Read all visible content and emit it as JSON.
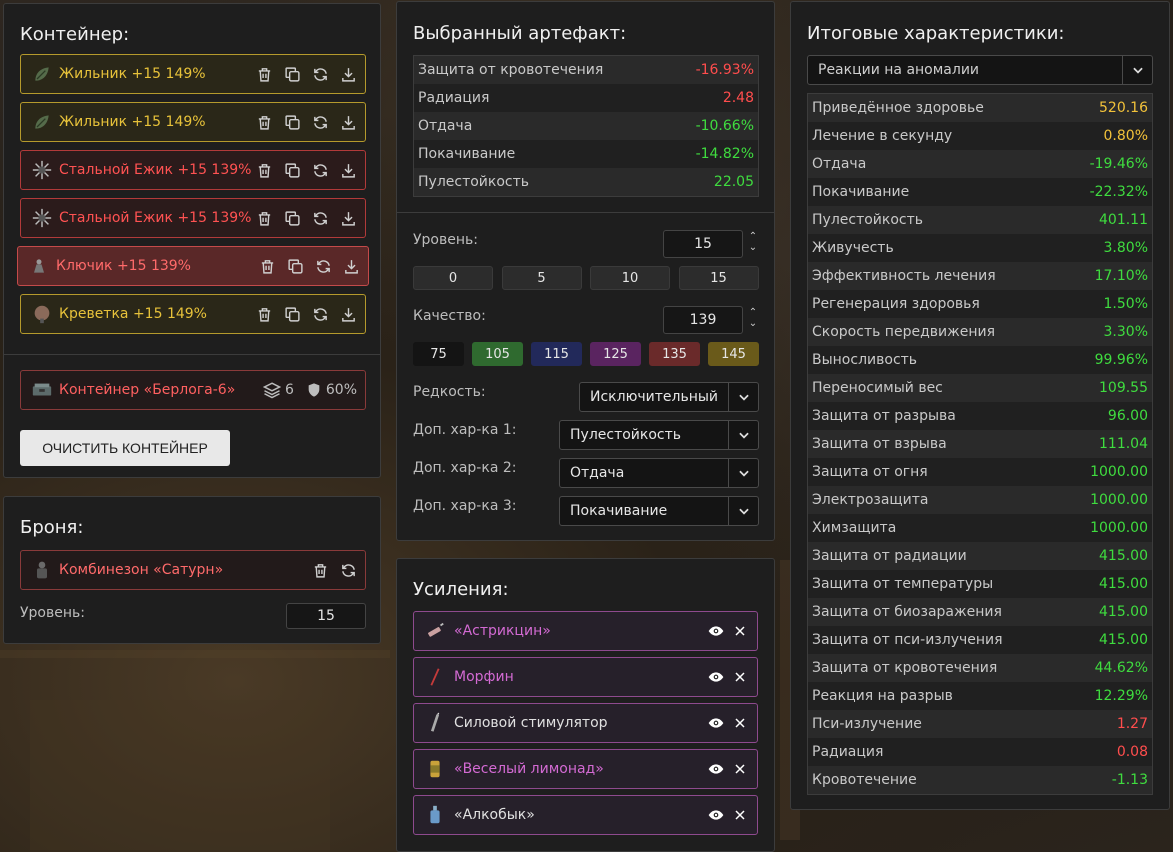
{
  "colors": {
    "gold": "#e7c23a",
    "red": "#ff5252",
    "green": "#3fdc3f",
    "purple": "#d36ad3"
  },
  "container": {
    "title": "Контейнер:",
    "items": [
      {
        "label": "Жильник +15 149%",
        "style": "gold",
        "icon": "leaf-artifact-icon"
      },
      {
        "label": "Жильник +15 149%",
        "style": "gold",
        "icon": "leaf-artifact-icon"
      },
      {
        "label": "Стальной Ежик +15 139%",
        "style": "red",
        "icon": "spiky-artifact-icon"
      },
      {
        "label": "Стальной Ежик +15 139%",
        "style": "red",
        "icon": "spiky-artifact-icon"
      },
      {
        "label": "Ключик +15 139%",
        "style": "red-sel",
        "icon": "key-artifact-icon"
      },
      {
        "label": "Креветка +15 149%",
        "style": "gold",
        "icon": "shrimp-artifact-icon"
      }
    ],
    "box": {
      "label": "Контейнер «Берлога-6»",
      "slots": "6",
      "protection": "60%"
    },
    "clear_label": "ОЧИСТИТЬ КОНТЕЙНЕР"
  },
  "armor": {
    "title": "Броня:",
    "item": "Комбинезон «Сатурн»",
    "level_label": "Уровень:",
    "level": "15"
  },
  "artifact": {
    "title": "Выбранный артефакт:",
    "stats": [
      {
        "label": "Защита от кровотечения",
        "value": "-16.93%",
        "color": "red"
      },
      {
        "label": "Радиация",
        "value": "2.48",
        "color": "red"
      },
      {
        "label": "Отдача",
        "value": "-10.66%",
        "color": "green"
      },
      {
        "label": "Покачивание",
        "value": "-14.82%",
        "color": "green"
      },
      {
        "label": "Пулестойкость",
        "value": "22.05",
        "color": "green"
      }
    ],
    "level_label": "Уровень:",
    "level": "15",
    "level_presets": [
      "0",
      "5",
      "10",
      "15"
    ],
    "quality_label": "Качество:",
    "quality": "139",
    "quality_presets": [
      {
        "label": "75",
        "bg": "#141414"
      },
      {
        "label": "105",
        "bg": "#2f6a2f"
      },
      {
        "label": "115",
        "bg": "#22295a"
      },
      {
        "label": "125",
        "bg": "#5a2460"
      },
      {
        "label": "135",
        "bg": "#6a2a2a"
      },
      {
        "label": "145",
        "bg": "#6a5a1a"
      }
    ],
    "rarity_label": "Редкость:",
    "rarity": "Исключительный",
    "extra1_label": "Доп. хар-ка 1:",
    "extra1": "Пулестойкость",
    "extra2_label": "Доп. хар-ка 2:",
    "extra2": "Отдача",
    "extra3_label": "Доп. хар-ка 3:",
    "extra3": "Покачивание"
  },
  "boosts": {
    "title": "Усиления:",
    "items": [
      {
        "label": "«Астрикцин»",
        "color": "#d36ad3",
        "icon": "syringe-icon"
      },
      {
        "label": "Морфин",
        "color": "#d36ad3",
        "icon": "needle-icon"
      },
      {
        "label": "Силовой стимулятор",
        "color": "#e0e0e0",
        "icon": "injector-icon"
      },
      {
        "label": "«Веселый лимонад»",
        "color": "#d36ad3",
        "icon": "can-icon"
      },
      {
        "label": "«Алкобык»",
        "color": "#e0e0e0",
        "icon": "bottle-icon"
      }
    ]
  },
  "summary": {
    "title": "Итоговые характеристики:",
    "filter": "Реакции на аномалии",
    "stats": [
      {
        "label": "Приведённое здоровье",
        "value": "520.16",
        "color": "gold"
      },
      {
        "label": "Лечение в секунду",
        "value": "0.80%",
        "color": "gold"
      },
      {
        "label": "Отдача",
        "value": "-19.46%",
        "color": "green"
      },
      {
        "label": "Покачивание",
        "value": "-22.32%",
        "color": "green"
      },
      {
        "label": "Пулестойкость",
        "value": "401.11",
        "color": "green"
      },
      {
        "label": "Живучесть",
        "value": "3.80%",
        "color": "green"
      },
      {
        "label": "Эффективность лечения",
        "value": "17.10%",
        "color": "green"
      },
      {
        "label": "Регенерация здоровья",
        "value": "1.50%",
        "color": "green"
      },
      {
        "label": "Скорость передвижения",
        "value": "3.30%",
        "color": "green"
      },
      {
        "label": "Выносливость",
        "value": "99.96%",
        "color": "green"
      },
      {
        "label": "Переносимый вес",
        "value": "109.55",
        "color": "green"
      },
      {
        "label": "Защита от разрыва",
        "value": "96.00",
        "color": "green"
      },
      {
        "label": "Защита от взрыва",
        "value": "111.04",
        "color": "green"
      },
      {
        "label": "Защита от огня",
        "value": "1000.00",
        "color": "green"
      },
      {
        "label": "Электрозащита",
        "value": "1000.00",
        "color": "green"
      },
      {
        "label": "Химзащита",
        "value": "1000.00",
        "color": "green"
      },
      {
        "label": "Защита от радиации",
        "value": "415.00",
        "color": "green"
      },
      {
        "label": "Защита от температуры",
        "value": "415.00",
        "color": "green"
      },
      {
        "label": "Защита от биозаражения",
        "value": "415.00",
        "color": "green"
      },
      {
        "label": "Защита от пси-излучения",
        "value": "415.00",
        "color": "green"
      },
      {
        "label": "Защита от кровотечения",
        "value": "44.62%",
        "color": "green"
      },
      {
        "label": "Реакция на разрыв",
        "value": "12.29%",
        "color": "green"
      },
      {
        "label": "Пси-излучение",
        "value": "1.27",
        "color": "red"
      },
      {
        "label": "Радиация",
        "value": "0.08",
        "color": "red"
      },
      {
        "label": "Кровотечение",
        "value": "-1.13",
        "color": "green"
      }
    ]
  }
}
